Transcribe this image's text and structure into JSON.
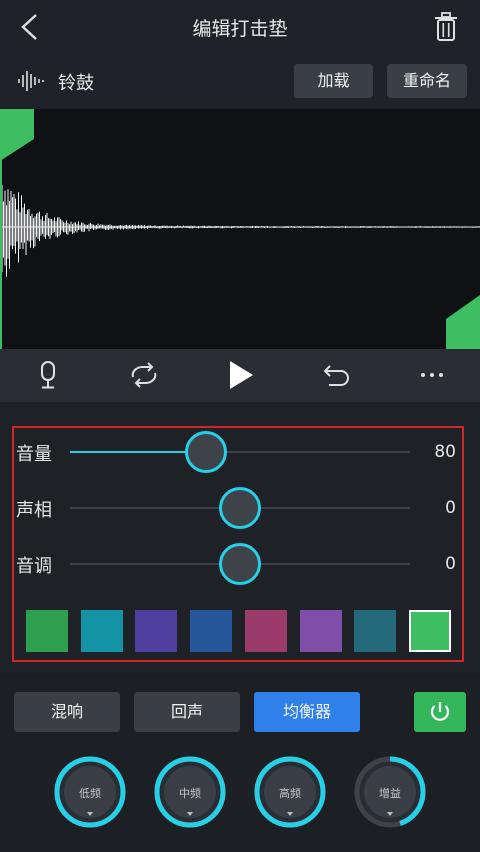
{
  "header": {
    "title": "编辑打击垫"
  },
  "pad": {
    "name": "铃鼓",
    "load_label": "加载",
    "rename_label": "重命名"
  },
  "sliders": [
    {
      "label": "音量",
      "value": "80",
      "fraction": 0.4
    },
    {
      "label": "声相",
      "value": "0",
      "fraction": 0.5
    },
    {
      "label": "音调",
      "value": "0",
      "fraction": 0.5
    }
  ],
  "swatches": [
    "#2e9e4f",
    "#1393a3",
    "#4f3f9e",
    "#27579b",
    "#9a3b6b",
    "#7e4ea8",
    "#246a7a",
    "#3fbe61"
  ],
  "selected_swatch": 7,
  "tabs": [
    {
      "label": "混响",
      "active": false
    },
    {
      "label": "回声",
      "active": false
    },
    {
      "label": "均衡器",
      "active": true
    }
  ],
  "dials": [
    {
      "label": "低频",
      "fraction": 0.0
    },
    {
      "label": "中频",
      "fraction": 0.0
    },
    {
      "label": "高频",
      "fraction": 0.0
    },
    {
      "label": "增益",
      "fraction": 0.45
    }
  ],
  "colors": {
    "accent": "#27d0e6",
    "green": "#3fbe61",
    "tab_active": "#2f80e8",
    "highlight": "#d0252b"
  }
}
